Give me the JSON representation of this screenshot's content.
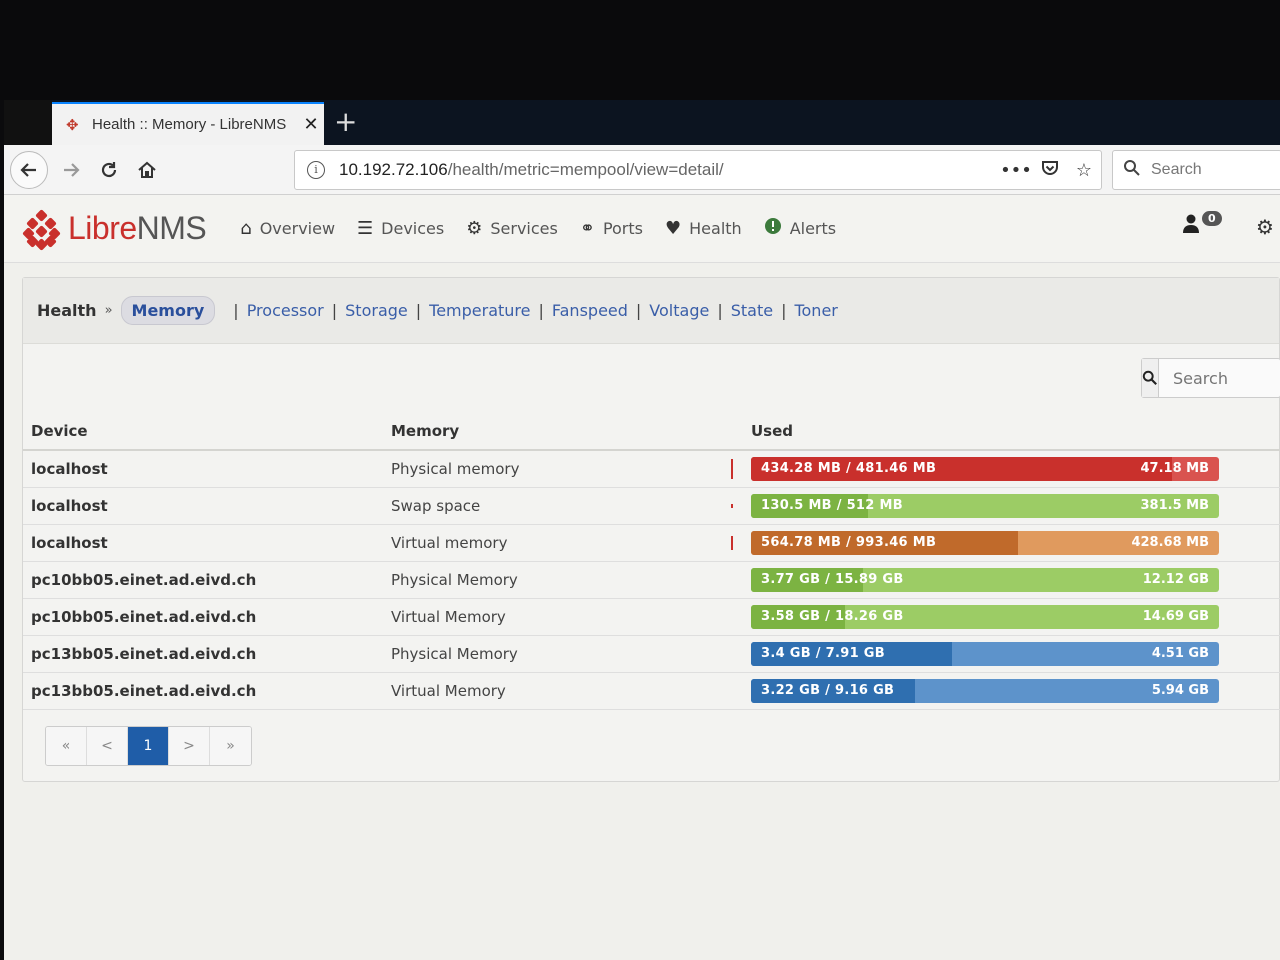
{
  "browser": {
    "tab_title": "Health :: Memory - LibreNMS",
    "tab_close": "✕",
    "new_tab": "+",
    "url_host": "10.192.72.106",
    "url_path": "/health/metric=mempool/view=detail/",
    "url_info": "i",
    "url_more": "•••",
    "search_placeholder": "Search"
  },
  "app": {
    "logo_libre": "Libre",
    "logo_nms": "NMS",
    "menu": [
      {
        "label": "Overview",
        "icon": "home-icon"
      },
      {
        "label": "Devices",
        "icon": "server-icon"
      },
      {
        "label": "Services",
        "icon": "cogs-icon"
      },
      {
        "label": "Ports",
        "icon": "link-icon"
      },
      {
        "label": "Health",
        "icon": "heartbeat-icon"
      },
      {
        "label": "Alerts",
        "icon": "exclamation-circle-icon"
      }
    ],
    "notification_count": "0"
  },
  "breadcrumb": {
    "root": "Health",
    "separator": "»",
    "active": "Memory",
    "links": [
      "Processor",
      "Storage",
      "Temperature",
      "Fanspeed",
      "Voltage",
      "State",
      "Toner"
    ]
  },
  "table": {
    "search_placeholder": "Search",
    "headers": {
      "device": "Device",
      "memory": "Memory",
      "used": "Used"
    },
    "rows": [
      {
        "device": "localhost",
        "memory": "Physical memory",
        "used": "434.28 MB / 481.46 MB",
        "free": "47.18 MB",
        "percent": 90,
        "color": "#c9302c",
        "light": "#d9534f"
      },
      {
        "device": "localhost",
        "memory": "Swap space",
        "used": "130.5 MB / 512 MB",
        "free": "381.5 MB",
        "percent": 25,
        "color": "#7cb342",
        "light": "#9ccc65"
      },
      {
        "device": "localhost",
        "memory": "Virtual memory",
        "used": "564.78 MB / 993.46 MB",
        "free": "428.68 MB",
        "percent": 57,
        "color": "#c06a2b",
        "light": "#e09a5e"
      },
      {
        "device": "pc10bb05.einet.ad.eivd.ch",
        "memory": "Physical Memory",
        "used": "3.77 GB / 15.89 GB",
        "free": "12.12 GB",
        "percent": 24,
        "color": "#7cb342",
        "light": "#9ccc65"
      },
      {
        "device": "pc10bb05.einet.ad.eivd.ch",
        "memory": "Virtual Memory",
        "used": "3.58 GB / 18.26 GB",
        "free": "14.69 GB",
        "percent": 20,
        "color": "#7cb342",
        "light": "#9ccc65"
      },
      {
        "device": "pc13bb05.einet.ad.eivd.ch",
        "memory": "Physical Memory",
        "used": "3.4 GB / 7.91 GB",
        "free": "4.51 GB",
        "percent": 43,
        "color": "#2f6fb0",
        "light": "#5d93cb"
      },
      {
        "device": "pc13bb05.einet.ad.eivd.ch",
        "memory": "Virtual Memory",
        "used": "3.22 GB / 9.16 GB",
        "free": "5.94 GB",
        "percent": 35,
        "color": "#2f6fb0",
        "light": "#5d93cb"
      }
    ]
  },
  "pagination": {
    "first": "«",
    "prev": "<",
    "current": "1",
    "next": ">",
    "last": "»"
  }
}
